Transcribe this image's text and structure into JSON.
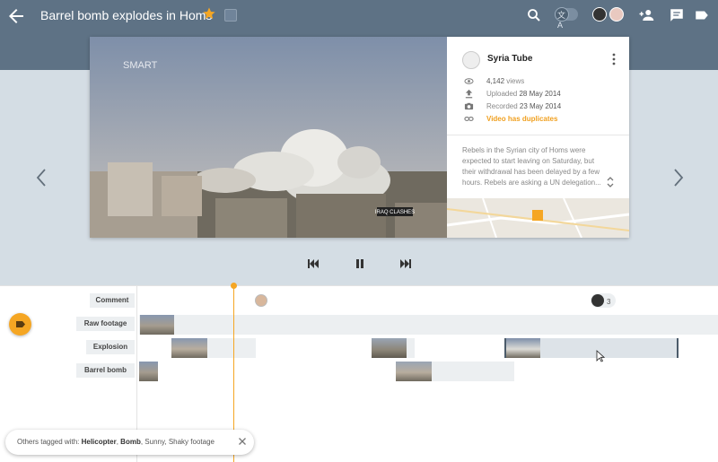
{
  "header": {
    "title": "Barrel bomb explodes in Homs",
    "icons": [
      "back-arrow-icon",
      "star-icon",
      "tag-icon",
      "search-icon",
      "translate-toggle-icon",
      "add-person-icon",
      "comment-icon",
      "label-icon"
    ],
    "translate_glyph": "文A",
    "colors": {
      "bar": "#5e7285",
      "star": "#f5a623"
    }
  },
  "video": {
    "watermark": "SMART",
    "overlay_badge": "IRAQ CLASHES"
  },
  "info": {
    "channel": "Syria Tube",
    "views": "4,142",
    "views_suffix": "views",
    "uploaded_label": "Uploaded",
    "uploaded_date": "28 May 2014",
    "recorded_label": "Recorded",
    "recorded_date": "23 May 2014",
    "duplicates_link": "Video has duplicates",
    "description": "Rebels in the Syrian city of Homs were expected to start leaving on Saturday, but their withdrawal has been delayed by a few hours. Rebels are asking a UN delegation..."
  },
  "player": {
    "controls": [
      "skip-previous-icon",
      "pause-icon",
      "skip-next-icon"
    ]
  },
  "timeline": {
    "lanes": [
      "Comment",
      "Raw footage",
      "Explosion",
      "Barrel bomb"
    ],
    "comment_count": "3",
    "accent": "#f5a623"
  },
  "snackbar": {
    "prefix": "Others tagged with: ",
    "tag1": "Helicopter",
    "tag2": "Bomb",
    "rest": ", Sunny, Shaky footage"
  }
}
